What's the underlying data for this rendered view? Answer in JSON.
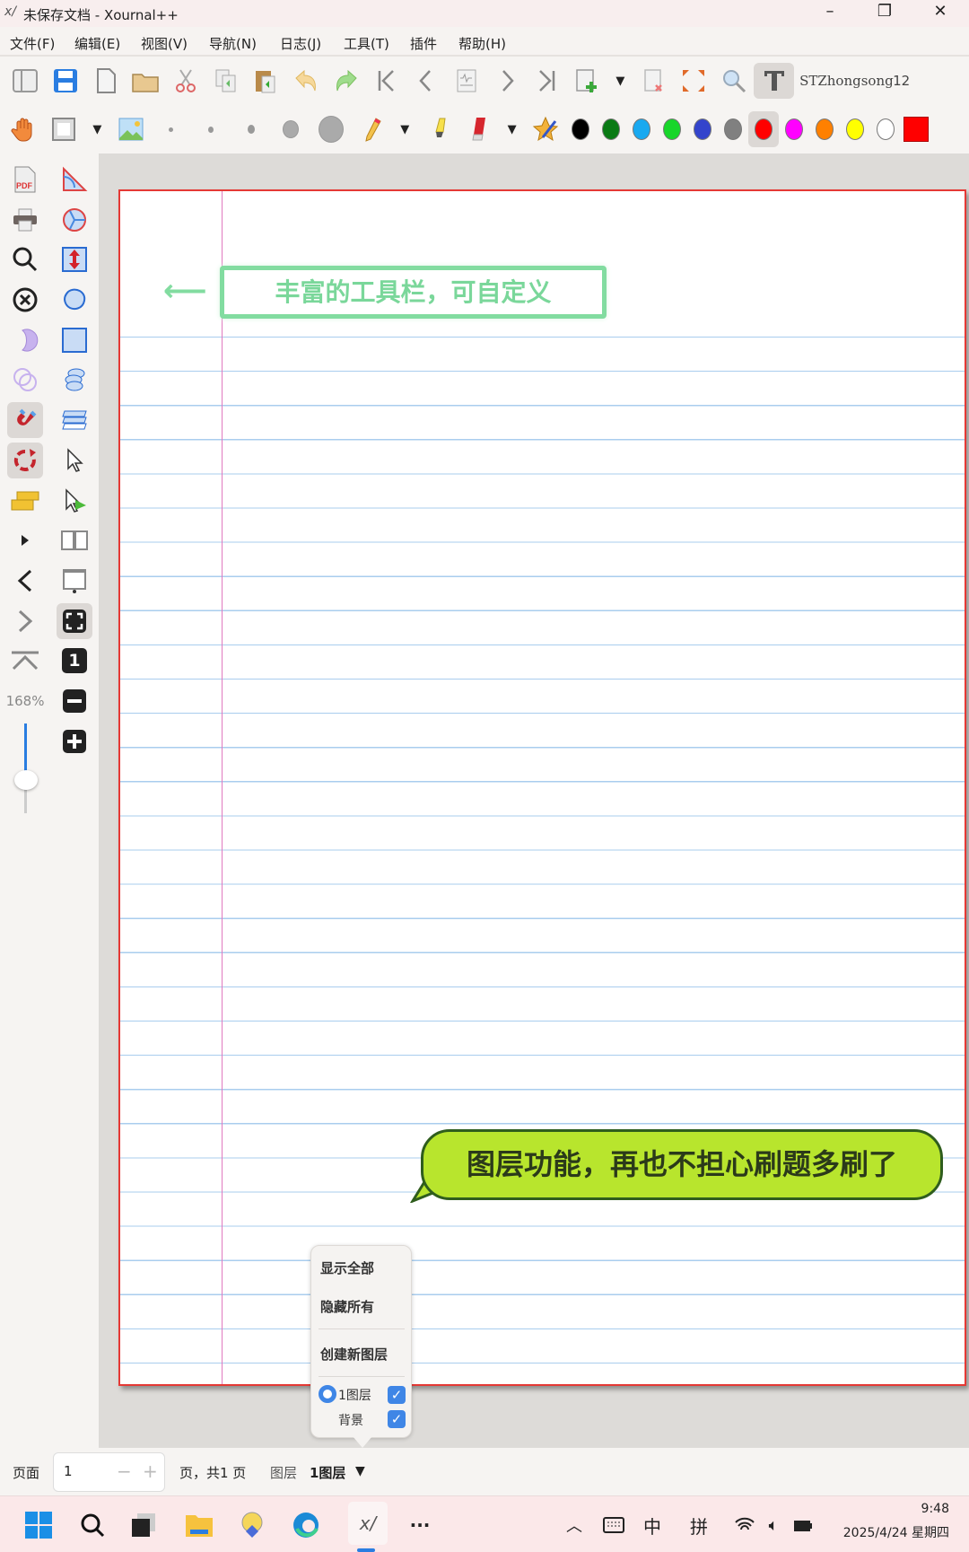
{
  "window": {
    "title": "未保存文档 - Xournal++",
    "minimize": "–",
    "restore": "❐",
    "close": "✕"
  },
  "menu": [
    "文件(F)",
    "编辑(E)",
    "视图(V)",
    "导航(N)",
    "日志(J)",
    "工具(T)",
    "插件",
    "帮助(H)"
  ],
  "toolbar": {
    "font_name": "STZhongsong",
    "font_size": "12"
  },
  "colors": [
    "#000000",
    "#0a7a14",
    "#19a9f0",
    "#18d62a",
    "#3344cc",
    "#808080",
    "#ff0000",
    "#ff00ff",
    "#ff8000",
    "#ffff00",
    "#ffffff"
  ],
  "selected_color": "#ff0000",
  "sidebar": {
    "zoom_level": "168%",
    "zoom_100_label": "1"
  },
  "annotations": {
    "toolbar_note": "丰富的工具栏，可自定义",
    "toolbar_arrow": "⟵",
    "layer_note": "图层功能，再也不担心刷题多刷了"
  },
  "layer_popup": {
    "show_all": "显示全部",
    "hide_all": "隐藏所有",
    "create_layer": "创建新图层",
    "layers": [
      {
        "name": "1图层",
        "visible": true,
        "selected": true
      },
      {
        "name": "背景",
        "visible": true
      }
    ]
  },
  "statusbar": {
    "page_label": "页面",
    "page_value": "1",
    "page_of": "页，共1 页",
    "layer_label": "图层",
    "layer_value": "1图层"
  },
  "taskbar": {
    "time": "9:48",
    "date": "2025/4/24 星期四",
    "ime_lang": "中",
    "ime_mode": "拼",
    "more": "···"
  }
}
